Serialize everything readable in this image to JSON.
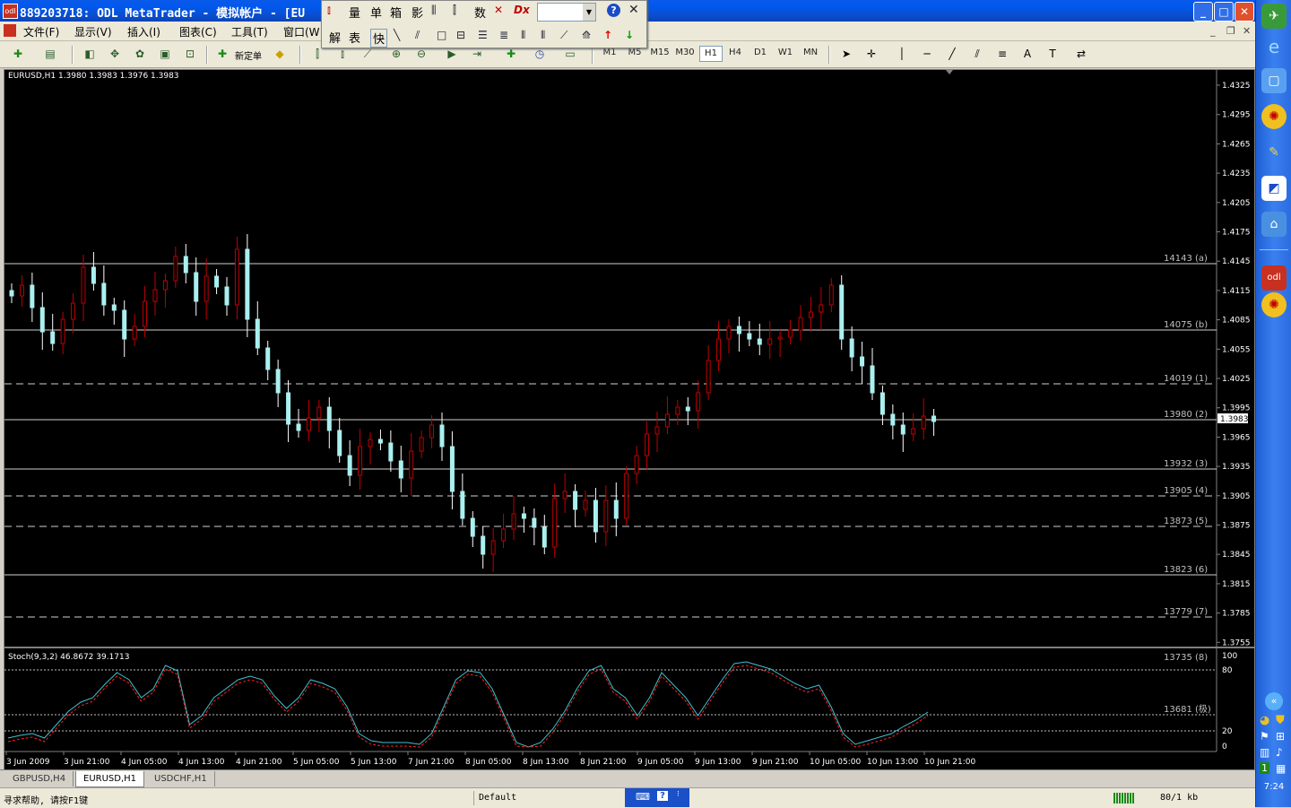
{
  "window": {
    "title": "889203718: ODL MetaTrader - 模拟帐户 - [EU",
    "icon": "metatrader-app-icon",
    "controls": [
      "minimize",
      "maximize",
      "close"
    ]
  },
  "menu": {
    "items": [
      "文件(F)",
      "显示(V)",
      "插入(I)",
      "图表(C)",
      "工具(T)",
      "窗口(W"
    ]
  },
  "toolbar": {
    "new_order_label": "新定单",
    "timeframes": [
      "M1",
      "M5",
      "M15",
      "M30",
      "H1",
      "H4",
      "D1",
      "W1",
      "MN"
    ],
    "active_timeframe": "H1"
  },
  "float_toolbar": {
    "row1": [
      "量",
      "单",
      "箱",
      "影",
      "数"
    ],
    "row2": [
      "解",
      "表",
      "快"
    ]
  },
  "chart": {
    "header": "EURUSD,H1  1.3980 1.3983 1.3976 1.3983",
    "price_labels": [
      "1.4325",
      "1.4295",
      "1.4265",
      "1.4235",
      "1.4205",
      "1.4175",
      "1.4145",
      "1.4115",
      "1.4085",
      "1.4055",
      "1.4025",
      "1.3995",
      "1.3965",
      "1.3935",
      "1.3905",
      "1.3875",
      "1.3845",
      "1.3815",
      "1.3785",
      "1.3755"
    ],
    "current_price": "1.3983",
    "levels": [
      {
        "label": "14143 (a)",
        "style": "solid"
      },
      {
        "label": "14075 (b)",
        "style": "solid"
      },
      {
        "label": "14019 (1)",
        "style": "dashed"
      },
      {
        "label": "13980 (2)",
        "style": "solid"
      },
      {
        "label": "13932 (3)",
        "style": "solid"
      },
      {
        "label": "13905 (4)",
        "style": "dashed"
      },
      {
        "label": "13873 (5)",
        "style": "dashed"
      },
      {
        "label": "13823 (6)",
        "style": "solid"
      },
      {
        "label": "13779 (7)",
        "style": "dashed"
      }
    ],
    "time_labels": [
      "3 Jun 2009",
      "3 Jun 21:00",
      "4 Jun 05:00",
      "4 Jun 13:00",
      "4 Jun 21:00",
      "5 Jun 05:00",
      "5 Jun 13:00",
      "7 Jun 21:00",
      "8 Jun 05:00",
      "8 Jun 13:00",
      "8 Jun 21:00",
      "9 Jun 05:00",
      "9 Jun 13:00",
      "9 Jun 21:00",
      "10 Jun 05:00",
      "10 Jun 13:00",
      "10 Jun 21:00"
    ],
    "colors": {
      "bull": "#c00000",
      "bear": "#aaf0f0",
      "bg": "#000000",
      "main": "#40c0d0",
      "signal": "#ff2020"
    }
  },
  "indicator": {
    "header": "Stoch(9,3,2) 46.8672 39.1713",
    "scale": [
      "100",
      "80",
      "20",
      "0"
    ],
    "levels_labels": [
      "13735 (8)",
      "13681 (极)"
    ]
  },
  "tabs": [
    "GBPUSD,H4",
    "EURUSD,H1",
    "USDCHF,H1"
  ],
  "active_tab": "EURUSD,H1",
  "status": {
    "help": "寻求帮助, 请按F1键",
    "profile": "Default",
    "traffic": "80/1 kb"
  },
  "taskbar": {
    "clock": "7:24"
  }
}
